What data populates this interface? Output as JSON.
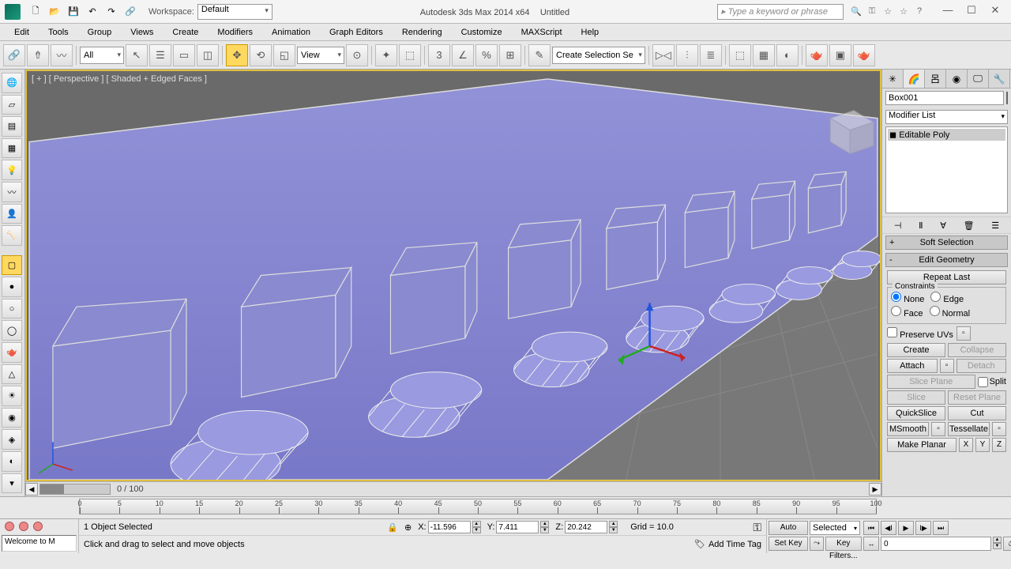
{
  "titlebar": {
    "workspace_label": "Workspace:",
    "workspace_value": "Default",
    "app_title": "Autodesk 3ds Max  2014 x64",
    "doc_title": "Untitled",
    "search_placeholder": "Type a keyword or phrase"
  },
  "menu": [
    "Edit",
    "Tools",
    "Group",
    "Views",
    "Create",
    "Modifiers",
    "Animation",
    "Graph Editors",
    "Rendering",
    "Customize",
    "MAXScript",
    "Help"
  ],
  "toolbar": {
    "sel_filter": "All",
    "named_set": "Create Selection Se",
    "ref_coord": "View"
  },
  "viewport": {
    "label": "[ + ] [ Perspective ] [ Shaded + Edged Faces ]",
    "scroll_frame": "0 / 100"
  },
  "right_panel": {
    "object_name": "Box001",
    "modifier_list": "Modifier List",
    "stack_item": "Editable Poly",
    "rollouts": {
      "soft_sel": "Soft Selection",
      "edit_geom": "Edit Geometry",
      "repeat_last": "Repeat Last",
      "constraints_legend": "Constraints",
      "c_none": "None",
      "c_edge": "Edge",
      "c_face": "Face",
      "c_normal": "Normal",
      "preserve_uvs": "Preserve UVs",
      "create": "Create",
      "collapse": "Collapse",
      "attach": "Attach",
      "detach": "Detach",
      "slice_plane": "Slice Plane",
      "split": "Split",
      "slice": "Slice",
      "reset_plane": "Reset Plane",
      "quickslice": "QuickSlice",
      "cut": "Cut",
      "msmooth": "MSmooth",
      "tessellate": "Tessellate",
      "make_planar": "Make Planar",
      "x": "X",
      "y": "Y",
      "z": "Z"
    }
  },
  "timeline": {
    "ticks": [
      0,
      5,
      10,
      15,
      20,
      25,
      30,
      35,
      40,
      45,
      50,
      55,
      60,
      65,
      70,
      75,
      80,
      85,
      90,
      95,
      100
    ]
  },
  "status": {
    "welcome": "Welcome to M",
    "selection": "1 Object Selected",
    "hint": "Click and drag to select and move objects",
    "x": "-11.596",
    "y": "7.411",
    "z": "20.242",
    "grid": "Grid = 10.0",
    "add_time_tag": "Add Time Tag",
    "auto_key": "Auto Key",
    "set_key": "Set Key",
    "key_mode": "Selected",
    "key_filters": "Key Filters...",
    "frame": "0"
  }
}
